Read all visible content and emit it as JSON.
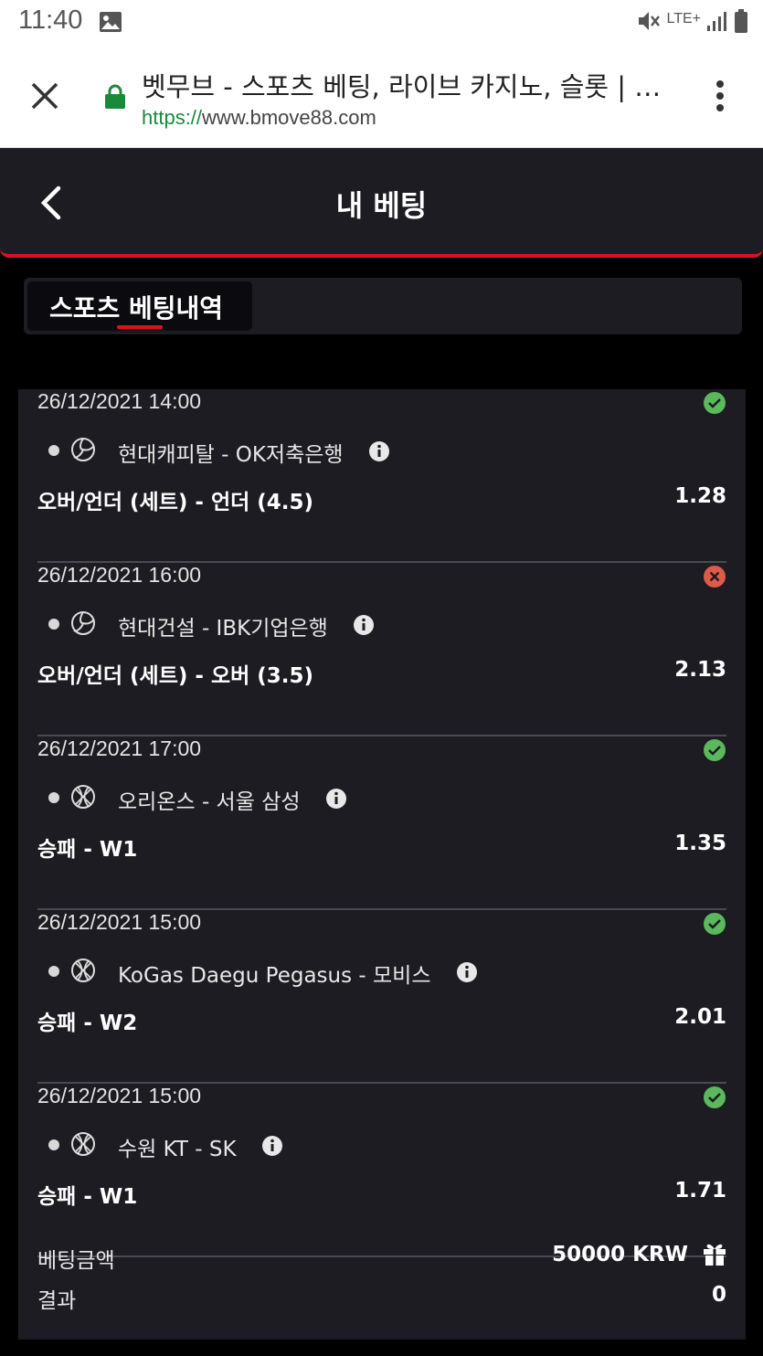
{
  "status_bar": {
    "time": "11:40",
    "network": "LTE+"
  },
  "browser": {
    "title": "벳무브 - 스포츠 베팅, 라이브 카지노, 슬롯 | …",
    "url_protocol": "https://",
    "url_host": "www.bmove88.com"
  },
  "header": {
    "title": "내 베팅"
  },
  "tabs": [
    {
      "label": "스포츠 베팅내역",
      "active": true
    }
  ],
  "bets": [
    {
      "date": "26/12/2021 14:00",
      "sport": "volleyball-icon",
      "match": "현대캐피탈 - OK저축은행",
      "market": "오버/언더 (세트) - 언더 (4.5)",
      "odds": "1.28",
      "status": "won"
    },
    {
      "date": "26/12/2021 16:00",
      "sport": "volleyball-icon",
      "match": "현대건설 - IBK기업은행",
      "market": "오버/언더 (세트) - 오버 (3.5)",
      "odds": "2.13",
      "status": "lost"
    },
    {
      "date": "26/12/2021 17:00",
      "sport": "basketball-icon",
      "match": "오리온스 - 서울 삼성",
      "market": "승패 - W1",
      "odds": "1.35",
      "status": "won"
    },
    {
      "date": "26/12/2021 15:00",
      "sport": "basketball-icon",
      "match": "KoGas Daegu Pegasus - 모비스",
      "market": "승패 - W2",
      "odds": "2.01",
      "status": "won"
    },
    {
      "date": "26/12/2021 15:00",
      "sport": "basketball-icon",
      "match": "수원 KT - SK",
      "market": "승패 - W1",
      "odds": "1.71",
      "status": "won"
    }
  ],
  "summary": {
    "stake_label": "베팅금액",
    "stake_value": "50000 KRW",
    "result_label": "결과",
    "result_value": "0"
  },
  "colors": {
    "accent": "#d7141e",
    "won": "#5cb85c",
    "lost": "#e05a4a",
    "panel": "#1c1c22"
  }
}
